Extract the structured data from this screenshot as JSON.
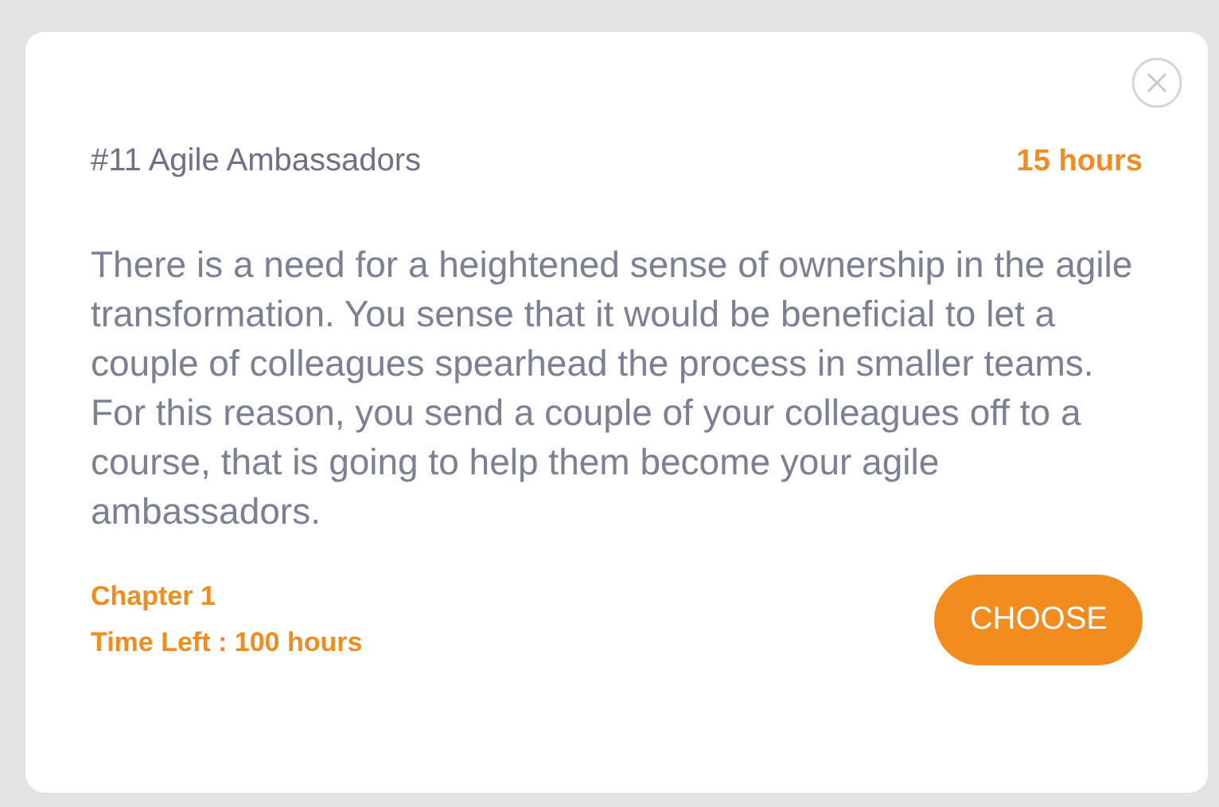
{
  "task": {
    "title": "#11 Agile Ambassadors",
    "duration": "15 hours",
    "description": "There is a need for a heightened sense of ownership in the agile transformation. You sense that it would be beneficial to let a couple of colleagues spearhead the process in smaller teams. For this reason, you send a couple of your colleagues off to a course, that is going to help them become your agile ambassadors."
  },
  "footer": {
    "chapter": "Chapter 1",
    "time_left": "Time Left : 100 hours"
  },
  "buttons": [
    "CHOOSE"
  ]
}
